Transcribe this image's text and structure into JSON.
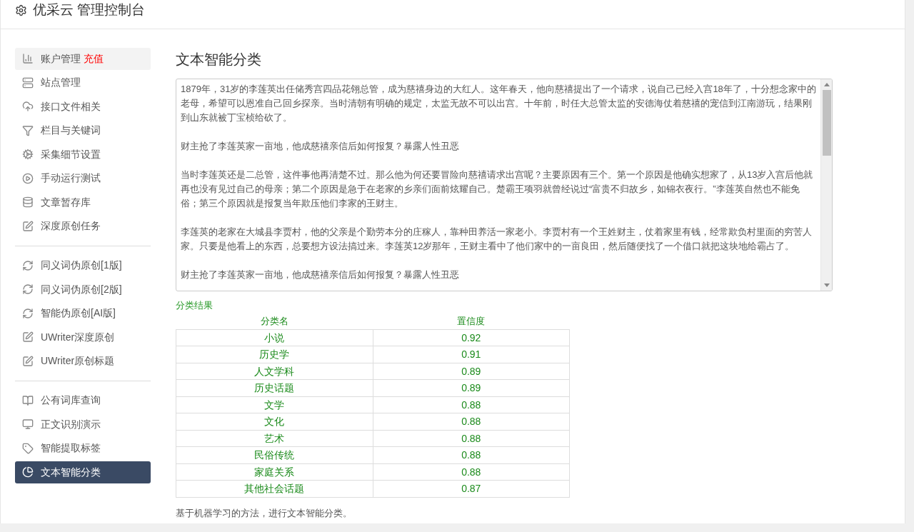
{
  "header": {
    "title": "优采云 管理控制台"
  },
  "sidebar": {
    "groups": [
      {
        "items": [
          {
            "label": "账户管理",
            "badge": "充值",
            "selected": false,
            "hover": true
          },
          {
            "label": "站点管理",
            "selected": false,
            "hover": false
          },
          {
            "label": "接口文件相关",
            "selected": false,
            "hover": false
          },
          {
            "label": "栏目与关键词",
            "selected": false,
            "hover": false
          },
          {
            "label": "采集细节设置",
            "selected": false,
            "hover": false
          },
          {
            "label": "手动运行测试",
            "selected": false,
            "hover": false
          },
          {
            "label": "文章暂存库",
            "selected": false,
            "hover": false
          },
          {
            "label": "深度原创任务",
            "selected": false,
            "hover": false
          }
        ]
      },
      {
        "items": [
          {
            "label": "同义词伪原创[1版]",
            "selected": false,
            "hover": false
          },
          {
            "label": "同义词伪原创[2版]",
            "selected": false,
            "hover": false
          },
          {
            "label": "智能伪原创[AI版]",
            "selected": false,
            "hover": false
          },
          {
            "label": "UWriter深度原创",
            "selected": false,
            "hover": false
          },
          {
            "label": "UWriter原创标题",
            "selected": false,
            "hover": false
          }
        ]
      },
      {
        "items": [
          {
            "label": "公有词库查询",
            "selected": false,
            "hover": false
          },
          {
            "label": "正文识别演示",
            "selected": false,
            "hover": false
          },
          {
            "label": "智能提取标签",
            "selected": false,
            "hover": false
          },
          {
            "label": "文本智能分类",
            "selected": true,
            "hover": false
          }
        ]
      }
    ]
  },
  "main": {
    "title": "文本智能分类",
    "text_area": {
      "paragraphs": [
        "1879年，31岁的李莲英出任储秀宫四品花翎总管，成为慈禧身边的大红人。这年春天，他向慈禧提出了一个请求，说自己已经入宫18年了，十分想念家中的老母，希望可以恩准自己回乡探亲。当时清朝有明确的规定，太监无故不可以出宫。十年前，时任大总管太监的安德海仗着慈禧的宠信到江南游玩，结果刚到山东就被丁宝桢给砍了。",
        "财主抢了李莲英家一亩地，他成慈禧亲信后如何报复？暴露人性丑恶",
        "当时李莲英还是二总管，这件事他再清楚不过。那么他为何还要冒险向慈禧请求出宫呢？主要原因有三个。第一个原因是他确实想家了，从13岁入宫后他就再也没有见过自己的母亲；第二个原因是急于在老家的乡亲们面前炫耀自己。楚霸王项羽就曾经说过“富贵不归故乡，如锦衣夜行。”李莲英自然也不能免俗；第三个原因就是报复当年欺压他们李家的王财主。",
        "李莲英的老家在大城县李贾村，他的父亲是个勤劳本分的庄稼人，靠种田养活一家老小。李贾村有一个王姓财主，仗着家里有钱，经常欺负村里面的穷苦人家。只要是他看上的东西，总要想方设法搞过来。李莲英12岁那年，王财主看中了他们家中的一亩良田，然后随便找了一个借口就把这块地给霸占了。",
        "财主抢了李莲英家一亩地，他成慈禧亲信后如何报复？暴露人性丑恶"
      ]
    },
    "result_title": "分类结果",
    "table": {
      "columns": [
        "分类名",
        "置信度"
      ],
      "rows": [
        [
          "小说",
          "0.92"
        ],
        [
          "历史学",
          "0.91"
        ],
        [
          "人文学科",
          "0.89"
        ],
        [
          "历史话题",
          "0.89"
        ],
        [
          "文学",
          "0.88"
        ],
        [
          "文化",
          "0.88"
        ],
        [
          "艺术",
          "0.88"
        ],
        [
          "民俗传统",
          "0.88"
        ],
        [
          "家庭关系",
          "0.88"
        ],
        [
          "其他社会话题",
          "0.87"
        ]
      ]
    },
    "note": "基于机器学习的方法，进行文本智能分类。"
  }
}
